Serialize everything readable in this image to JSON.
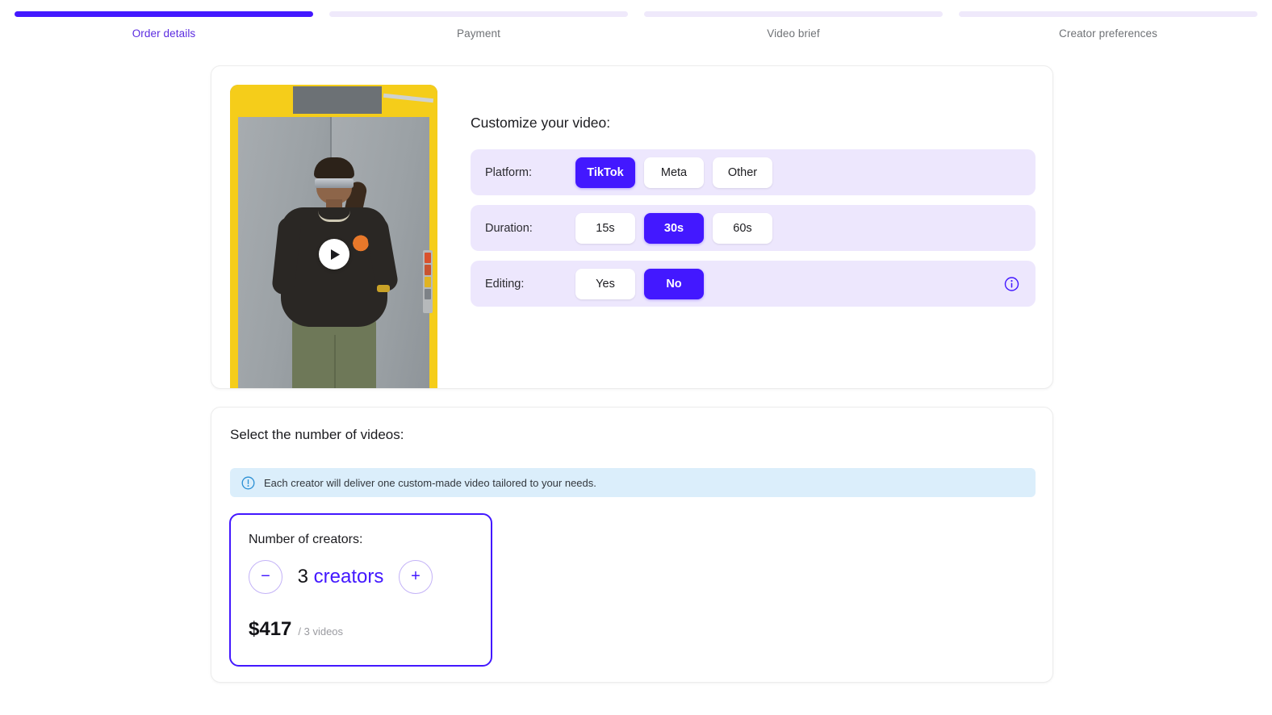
{
  "stepper": {
    "steps": [
      {
        "label": "Order details",
        "active": true
      },
      {
        "label": "Payment",
        "active": false
      },
      {
        "label": "Video brief",
        "active": false
      },
      {
        "label": "Creator preferences",
        "active": false
      }
    ]
  },
  "customize": {
    "title": "Customize your video:",
    "video_preview": {
      "play_icon": "play-icon",
      "alt": "creator video preview"
    },
    "rows": [
      {
        "label": "Platform:",
        "options": [
          {
            "label": "TikTok",
            "selected": true
          },
          {
            "label": "Meta",
            "selected": false
          },
          {
            "label": "Other",
            "selected": false
          }
        ],
        "info_icon": false
      },
      {
        "label": "Duration:",
        "options": [
          {
            "label": "15s",
            "selected": false
          },
          {
            "label": "30s",
            "selected": true
          },
          {
            "label": "60s",
            "selected": false
          }
        ],
        "info_icon": false
      },
      {
        "label": "Editing:",
        "options": [
          {
            "label": "Yes",
            "selected": false
          },
          {
            "label": "No",
            "selected": true
          }
        ],
        "info_icon": true,
        "info_icon_name": "info-circle-icon"
      }
    ]
  },
  "videos": {
    "title": "Select the number of videos:",
    "alert": {
      "icon": "alert-circle-icon",
      "text": "Each creator will deliver one custom-made video tailored to your needs."
    },
    "counter": {
      "title": "Number of creators:",
      "decrement_label": "−",
      "increment_label": "+",
      "count": "3",
      "unit": " creators",
      "price": "$417",
      "price_sub": "/ 3 videos"
    }
  },
  "colors": {
    "accent": "#4318ff",
    "accent_soft": "#ede7fd",
    "step_inactive": "#efe9fb",
    "alert_bg": "#dbeefb",
    "alert_icon": "#2a8fd4"
  }
}
